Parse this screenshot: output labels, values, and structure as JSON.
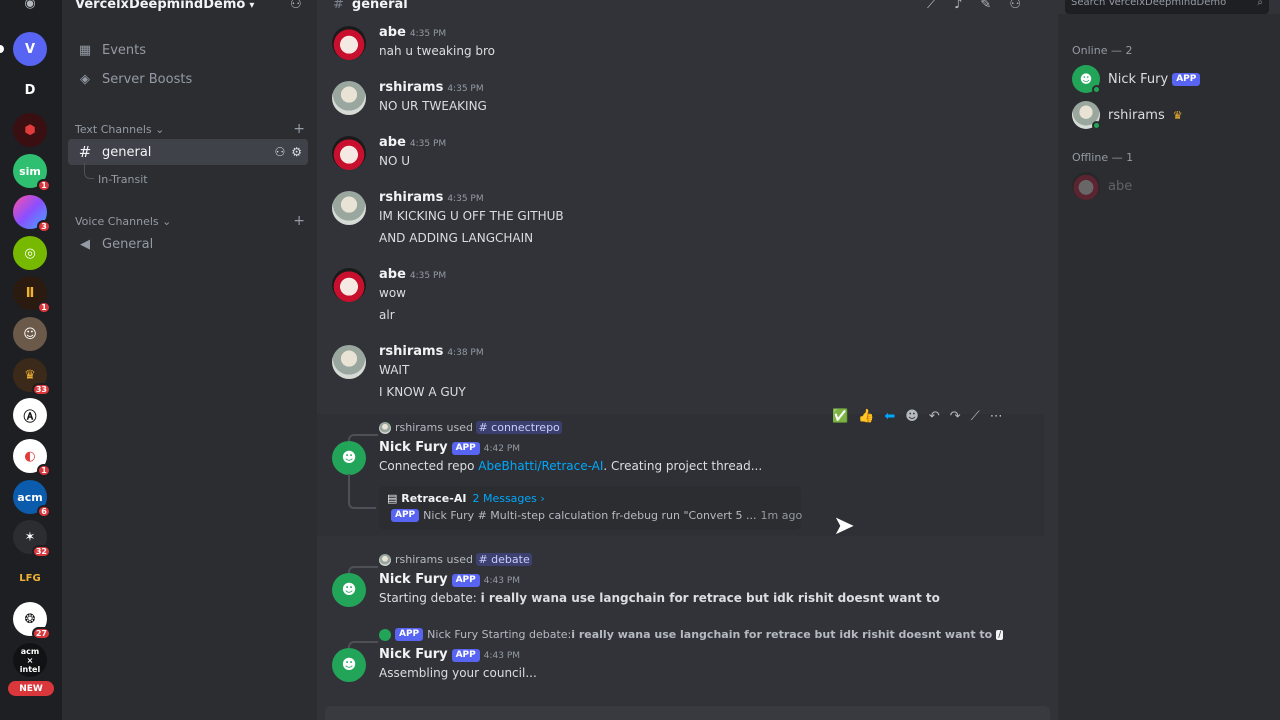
{
  "server": {
    "name": "VercelxDeepmindDemo"
  },
  "rail": {
    "servers": [
      {
        "label": "",
        "color": "#5865f2",
        "badge": ""
      },
      {
        "label": "V",
        "color": "#5865f2",
        "badge": ""
      },
      {
        "label": "D",
        "color": "#1e1f22",
        "badge": ""
      },
      {
        "label": "",
        "color": "#3a0f12",
        "badge": ""
      },
      {
        "label": "sim",
        "color": "#2fbf71",
        "badge": "1"
      },
      {
        "label": "",
        "color": "#8a4fff",
        "badge": "3"
      },
      {
        "label": "",
        "color": "#76b900",
        "badge": ""
      },
      {
        "label": "",
        "color": "#2a1a10",
        "badge": "1"
      },
      {
        "label": "",
        "color": "#6b5a4a",
        "badge": ""
      },
      {
        "label": "",
        "color": "#3b2a1a",
        "badge": "33"
      },
      {
        "label": "",
        "color": "#ffffff",
        "badge": ""
      },
      {
        "label": "",
        "color": "#ffffff",
        "badge": "1"
      },
      {
        "label": "acm",
        "color": "#0b5cad",
        "badge": "6"
      },
      {
        "label": "",
        "color": "#2b2d31",
        "badge": "32"
      },
      {
        "label": "",
        "color": "#1e1f22",
        "badge": ""
      },
      {
        "label": "",
        "color": "#ffffff",
        "badge": "27"
      },
      {
        "label": "acm\n×\nintel",
        "color": "#111214",
        "badge": ""
      }
    ],
    "new_label": "NEW"
  },
  "sidebar": {
    "events": "Events",
    "boosts": "Server Boosts",
    "text_category": "Text Channels",
    "channel_general": "general",
    "thread_intransit": "In-Transit",
    "voice_category": "Voice Channels",
    "voice_general": "General"
  },
  "header": {
    "channel": "general",
    "search_placeholder": "Search VercelxDeepmindDemo"
  },
  "messages": {
    "m1": {
      "user": "abe",
      "time": "4:35 PM",
      "lines": [
        "nah u tweaking bro"
      ]
    },
    "m2": {
      "user": "rshirams",
      "time": "4:35 PM",
      "lines": [
        "NO UR TWEAKING"
      ]
    },
    "m3": {
      "user": "abe",
      "time": "4:35 PM",
      "lines": [
        "NO U"
      ]
    },
    "m4": {
      "user": "rshirams",
      "time": "4:35 PM",
      "lines": [
        "IM KICKING U OFF THE GITHUB",
        "AND ADDING LANGCHAIN"
      ]
    },
    "m5": {
      "user": "abe",
      "time": "4:35 PM",
      "lines": [
        "wow",
        "alr"
      ]
    },
    "m6": {
      "user": "rshirams",
      "time": "4:38 PM",
      "lines": [
        "WAIT",
        "I KNOW A GUY"
      ]
    },
    "m7": {
      "reply_user": "rshirams",
      "reply_used": "used",
      "reply_cmd": "# connectrepo",
      "user": "Nick Fury",
      "app": "APP",
      "time": "4:42 PM",
      "text_pre": "Connected repo ",
      "link": "AbeBhatti/Retrace-AI",
      "text_post": ". Creating project thread...",
      "thread_name": "Retrace-AI",
      "thread_count": "2 Messages ›",
      "thread_preview": "Nick Fury # Multi-step calculation fr-debug run \"Convert 5 ...",
      "thread_ago": "1m ago"
    },
    "m8": {
      "reply_user": "rshirams",
      "reply_used": "used",
      "reply_cmd": "# debate",
      "user": "Nick Fury",
      "app": "APP",
      "time": "4:43 PM",
      "text_pre": "Starting debate: ",
      "text_bold": "i really wana use langchain for retrace but idk rishit doesnt want to"
    },
    "m9": {
      "reply_user": "Nick Fury",
      "reply_text": "Starting debate: ",
      "reply_bold": "i really wana use langchain for retrace but idk rishit doesnt want to",
      "user": "Nick Fury",
      "app": "APP",
      "time": "4:43 PM",
      "text": "Assembling your council..."
    }
  },
  "members": {
    "online_header": "Online — 2",
    "offline_header": "Offline — 1",
    "online": [
      {
        "name": "Nick Fury",
        "app": "APP"
      },
      {
        "name": "rshirams"
      }
    ],
    "offline": [
      {
        "name": "abe"
      }
    ]
  },
  "colors": {
    "accent": "#5865f2",
    "online": "#23a559",
    "link": "#00a8fc",
    "mention_badge": "#da373c"
  }
}
